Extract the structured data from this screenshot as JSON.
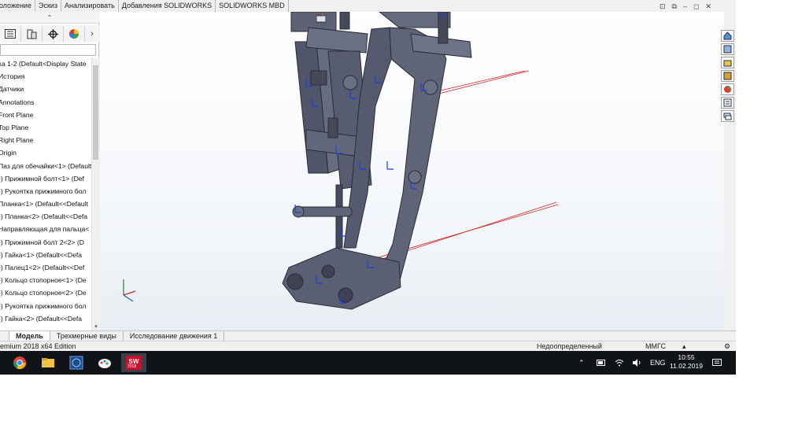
{
  "command_tabs": [
    "положение",
    "Эскиз",
    "Анализировать",
    "Добавления SOLIDWORKS",
    "SOLIDWORKS MBD"
  ],
  "panel": {
    "collapse_glyph": "⌃",
    "tabs": [
      "feature-manager-icon",
      "property-manager-icon",
      "configuration-manager-icon",
      "display-manager-icon"
    ],
    "more_glyph": "›"
  },
  "tree": {
    "items": [
      "ка 1-2  (Default<Display State",
      "История",
      "Датчики",
      "Annotations",
      "Front Plane",
      "Top Plane",
      "Right Plane",
      "Origin",
      "Паз для обечайки<1> (Default",
      "-) Прижимной болт<1> (Def",
      "-) Рукоятка прижимного бол",
      "Планка<1> (Default<<Default",
      "-) Планка<2> (Default<<Defa",
      "Направляющая для пальца<",
      "-) Прижимной болт 2<2> (D",
      "-) Гайка<1> (Default<<Defa",
      "-) Палец1<2> (Default<<Def",
      "-) Кольцо стопорное<1> (De",
      "-) Кольцо стопорное<2> (De",
      "-) Рукоятка прижимного бол",
      "-) Гайка<2> (Default<<Defa"
    ]
  },
  "bottom_tabs": [
    "Модель",
    "Трехмерные виды",
    "Исследование движения 1"
  ],
  "status": {
    "edition": "emium 2018 x64 Edition",
    "definition": "Недоопределенный",
    "units": "ММГС",
    "units_arrow": "▴"
  },
  "taskbar": {
    "apps": [
      "chrome-icon",
      "file-explorer-icon",
      "app-cube-icon",
      "paint-icon",
      "solidworks-icon"
    ],
    "sw_badge": "2018",
    "lang": "ENG",
    "time": "10:55",
    "date": "11.02.2019"
  },
  "colors": {
    "model_body": "#5d6275",
    "model_edge": "#2a2d38",
    "axis_marker": "#1f3fd6",
    "ray": "#d62020",
    "taskbar": "#101318"
  }
}
